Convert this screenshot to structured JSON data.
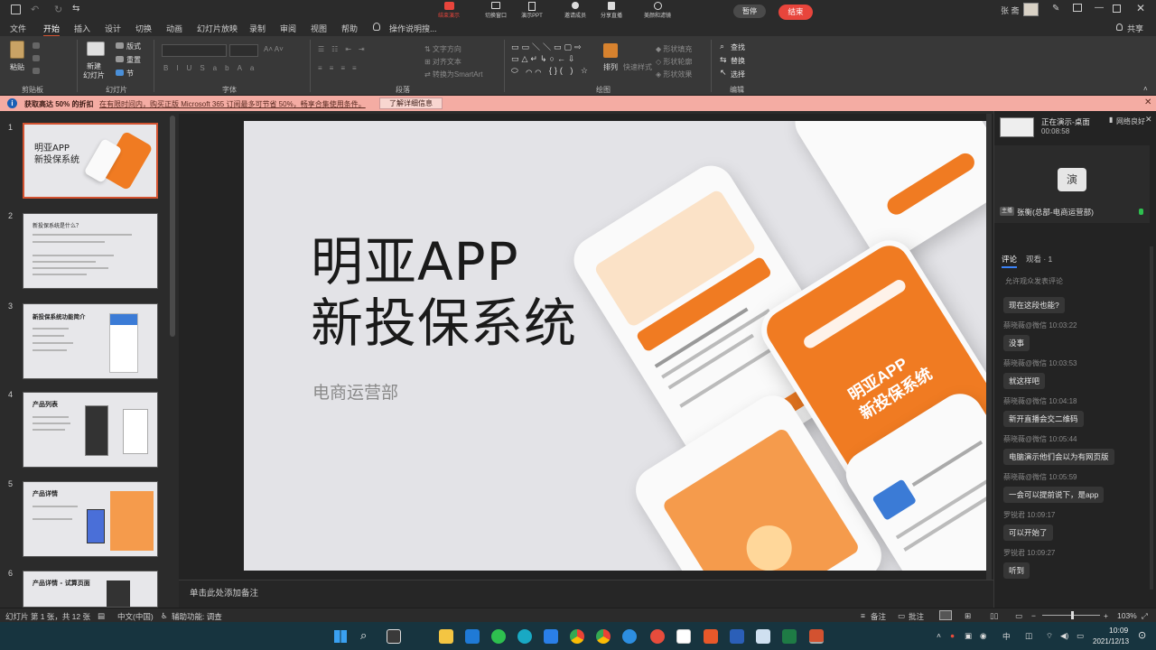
{
  "titlebar": {
    "center_buttons": [
      "结束演示",
      "切换窗口",
      "演示PPT",
      "邀请成员",
      "分享直播",
      "美颜和滤镜"
    ],
    "pause_label": "暂停",
    "end_label": "结束",
    "user_name": "张 斋"
  },
  "menu": {
    "tabs": [
      "文件",
      "开始",
      "插入",
      "设计",
      "切换",
      "动画",
      "幻灯片放映",
      "录制",
      "审阅",
      "视图",
      "帮助"
    ],
    "tell_me": "操作说明搜...",
    "share": "共享"
  },
  "ribbon": {
    "clipboard": {
      "paste": "粘贴",
      "label": "剪贴板"
    },
    "slides": {
      "new": "新建\n幻灯片",
      "layout": "版式",
      "reset": "重置",
      "section": "节",
      "label": "幻灯片"
    },
    "font": {
      "label": "字体"
    },
    "paragraph": {
      "label": "段落"
    },
    "drawing": {
      "arrange": "排列",
      "label": "绘图"
    },
    "editing": {
      "find": "查找",
      "replace": "替换",
      "select": "选择",
      "label": "编辑"
    }
  },
  "infobar": {
    "title": "获取高达 50% 的折扣",
    "message": "在有限时间内，购买正版 Microsoft 365 订阅最多可节省 50%，畅享合集使用条件。",
    "button": "了解详细信息"
  },
  "thumbnails": [
    {
      "num": "1",
      "title": "明亚APP\n新投保系统"
    },
    {
      "num": "2",
      "title": "新投保系统是什么？"
    },
    {
      "num": "3",
      "title": "新投保系统功能简介"
    },
    {
      "num": "4",
      "title": "产品列表"
    },
    {
      "num": "5",
      "title": "产品详情"
    },
    {
      "num": "6",
      "title": "产品详情 - 试算页面"
    }
  ],
  "slide": {
    "title_line1": "明亚APP",
    "title_line2": "新投保系统",
    "subtitle": "电商运营部",
    "phone_title": "明亚APP\n新投保系统"
  },
  "notes": {
    "placeholder": "单击此处添加备注"
  },
  "live": {
    "status": "正在演示-桌面",
    "time": "00:08:58",
    "network": "网络良好",
    "presenter": "张衡(总部-电商运营部)",
    "tabs": {
      "comments": "评论",
      "viewers": "观看 · 1"
    },
    "allow": "允许观众发表评论",
    "comments": [
      {
        "text": "现在这段也能?"
      },
      {
        "name": "蔡晓薇@微信",
        "time": "10:03:22",
        "text": "没事"
      },
      {
        "name": "蔡晓薇@微信",
        "time": "10:03:53",
        "text": "就这样吧"
      },
      {
        "name": "蔡晓薇@微信",
        "time": "10:04:18",
        "text": "新开直播会交二维码"
      },
      {
        "name": "蔡晓薇@微信",
        "time": "10:05:44",
        "text": "电脑演示他们会以为有网页版"
      },
      {
        "name": "蔡晓薇@微信",
        "time": "10:05:59",
        "text": "一会可以提前说下，是app"
      },
      {
        "name": "罗锐君",
        "time": "10:09:17",
        "text": "可以开始了"
      },
      {
        "name": "罗锐君",
        "time": "10:09:27",
        "text": "听到"
      }
    ]
  },
  "status": {
    "slide_of": "幻灯片 第 1 张，共 12 张",
    "language": "中文(中国)",
    "accessibility": "辅助功能: 调查",
    "notes": "备注",
    "comments": "批注",
    "zoom": "103%"
  },
  "taskbar": {
    "time": "10:09",
    "date": "2021/12/13",
    "lang": "中"
  },
  "colors": {
    "accent": "#d35230",
    "orange": "#f07b22",
    "end_red": "#e8453c",
    "infobar": "#f4aca3",
    "taskbar": "#17343f"
  }
}
